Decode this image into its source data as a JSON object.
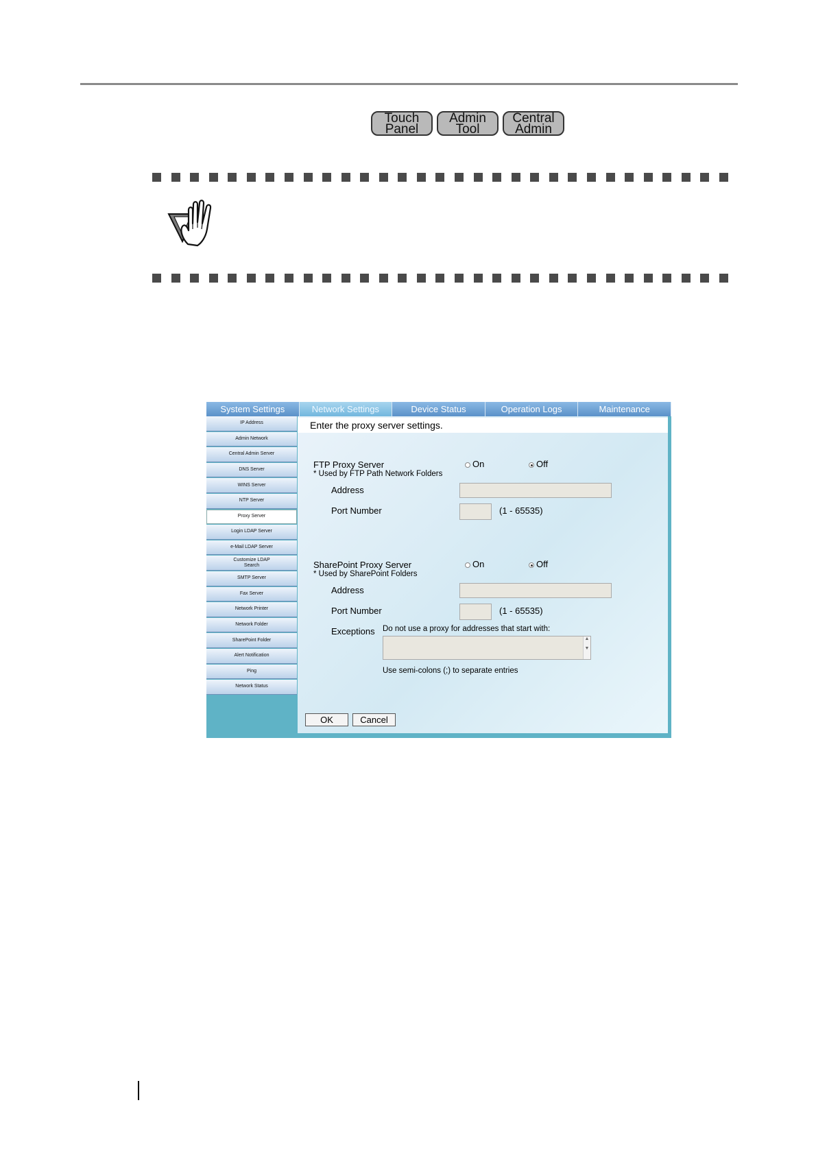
{
  "badges": {
    "touch_panel": [
      "Touch",
      "Panel"
    ],
    "admin_tool": [
      "Admin",
      "Tool"
    ],
    "central_admin": [
      "Central",
      "Admin"
    ]
  },
  "app": {
    "tabs": [
      "System Settings",
      "Network Settings",
      "Device Status",
      "Operation Logs",
      "Maintenance"
    ],
    "active_tab": "Network Settings",
    "sidebar": [
      "IP Address",
      "Admin Network",
      "Central Admin Server",
      "DNS Server",
      "WINS Server",
      "NTP Server",
      "Proxy Server",
      "Login LDAP Server",
      "e-Mail LDAP Server",
      "Customize LDAP Search",
      "SMTP Server",
      "Fax Server",
      "Network Printer",
      "Network Folder",
      "SharePoint Folder",
      "Alert Notification",
      "Ping",
      "Network Status"
    ],
    "active_sidebar_item": "Proxy Server",
    "header": "Enter the proxy server settings.",
    "ftp": {
      "title": "FTP Proxy Server",
      "note": "* Used by FTP Path Network Folders",
      "on_label": "On",
      "off_label": "Off",
      "selected": "Off",
      "address_label": "Address",
      "address_value": "",
      "port_label": "Port Number",
      "port_value": "",
      "port_range": "(1 - 65535)"
    },
    "sharepoint": {
      "title": "SharePoint Proxy Server",
      "note": "* Used by SharePoint Folders",
      "on_label": "On",
      "off_label": "Off",
      "selected": "Off",
      "address_label": "Address",
      "address_value": "",
      "port_label": "Port Number",
      "port_value": "",
      "port_range": "(1 - 65535)",
      "exceptions_label": "Exceptions",
      "exceptions_hint": "Do not use a proxy for addresses that start with:",
      "exceptions_value": "",
      "exceptions_note": "Use semi-colons (;) to separate entries"
    },
    "ok_label": "OK",
    "cancel_label": "Cancel"
  }
}
